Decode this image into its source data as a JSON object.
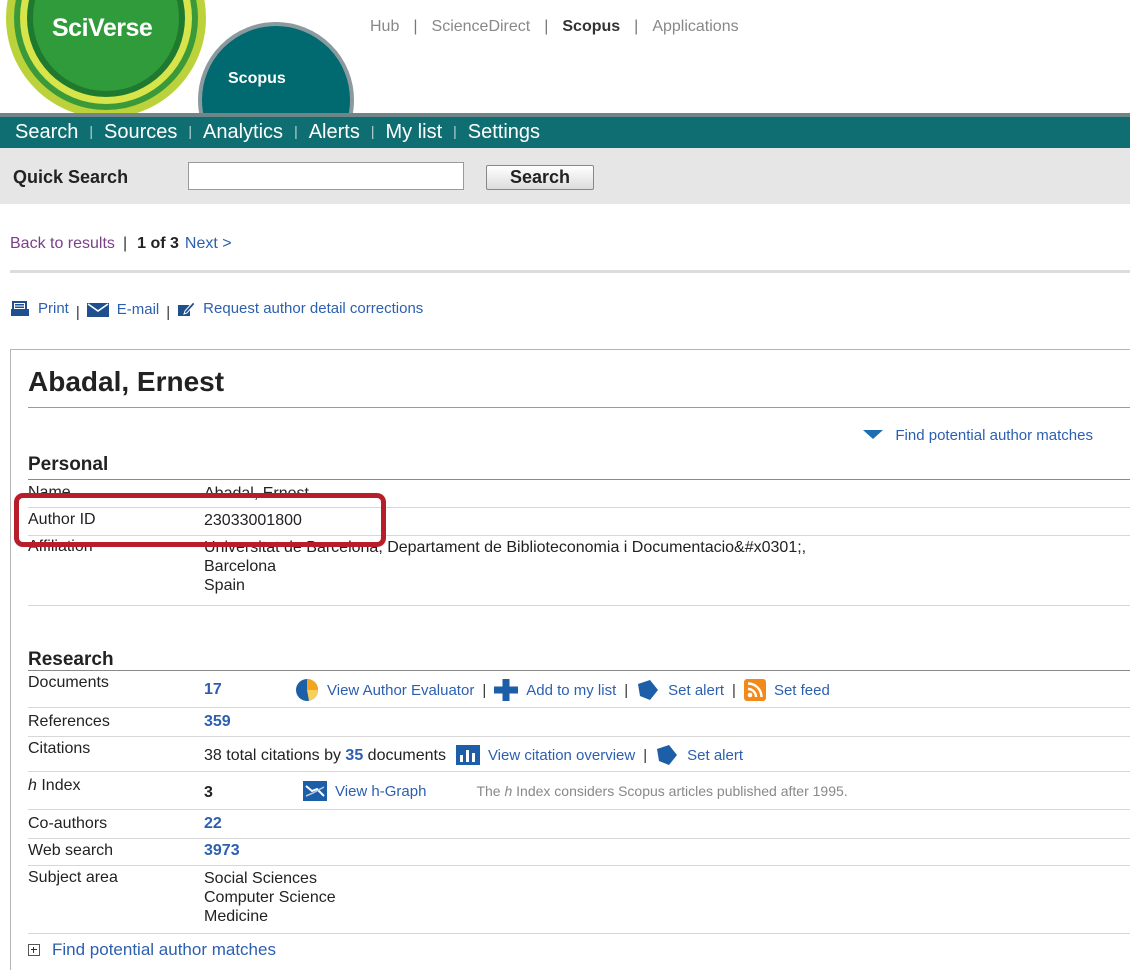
{
  "brand": {
    "sciverse": "SciVerse",
    "scopus": "Scopus"
  },
  "topnav": {
    "items": [
      "Hub",
      "ScienceDirect",
      "Scopus",
      "Applications"
    ],
    "separator": "|"
  },
  "mainnav": {
    "items": [
      "Search",
      "Sources",
      "Analytics",
      "Alerts",
      "My list",
      "Settings"
    ],
    "separator": "|"
  },
  "quicksearch": {
    "label": "Quick Search",
    "value": "",
    "button": "Search"
  },
  "resultsnav": {
    "back": "Back to results",
    "separator": "|",
    "position": "1 of 3",
    "next": "Next >"
  },
  "tools": {
    "print": "Print",
    "email": "E-mail",
    "request": "Request author detail corrections",
    "separator": "|"
  },
  "author": {
    "name": "Abadal, Ernest",
    "find_matches_top": "Find potential author matches",
    "find_matches_bottom": "Find potential author matches"
  },
  "personal": {
    "heading": "Personal",
    "name_label": "Name",
    "name_value": "Abadal, Ernest",
    "id_label": "Author ID",
    "id_value": "23033001800",
    "affiliation_label": "Affiliation",
    "affiliation_line1": "Universitat de Barcelona, Departament de Biblioteconomia i Documentacio&#x0301;,",
    "affiliation_line2": "Barcelona",
    "affiliation_line3": "Spain"
  },
  "research": {
    "heading": "Research",
    "documents_label": "Documents",
    "documents_value": "17",
    "view_author_evaluator": "View Author Evaluator",
    "add_to_list": "Add to my list",
    "set_alert": "Set alert",
    "set_feed": "Set feed",
    "references_label": "References",
    "references_value": "359",
    "citations_label": "Citations",
    "citations_prefix": "38 total citations by",
    "citations_docs": "35",
    "citations_suffix": "documents",
    "view_citation_overview": "View citation overview",
    "citations_set_alert": "Set alert",
    "hindex_label_h": "h",
    "hindex_label_rest": " Index",
    "hindex_value": "3",
    "view_hgraph": "View h-Graph",
    "hindex_note_a": "The ",
    "hindex_note_h": "h",
    "hindex_note_b": " Index considers Scopus articles published after 1995.",
    "coauthors_label": "Co-authors",
    "coauthors_value": "22",
    "websearch_label": "Web search",
    "websearch_value": "3973",
    "subject_label": "Subject area",
    "subjects": [
      "Social Sciences",
      "Computer Science",
      "Medicine"
    ]
  },
  "colors": {
    "nav_bg": "#0f6e71",
    "link": "#2c5fb0",
    "highlight": "#b81d2a",
    "visited": "#7b3f8a"
  }
}
